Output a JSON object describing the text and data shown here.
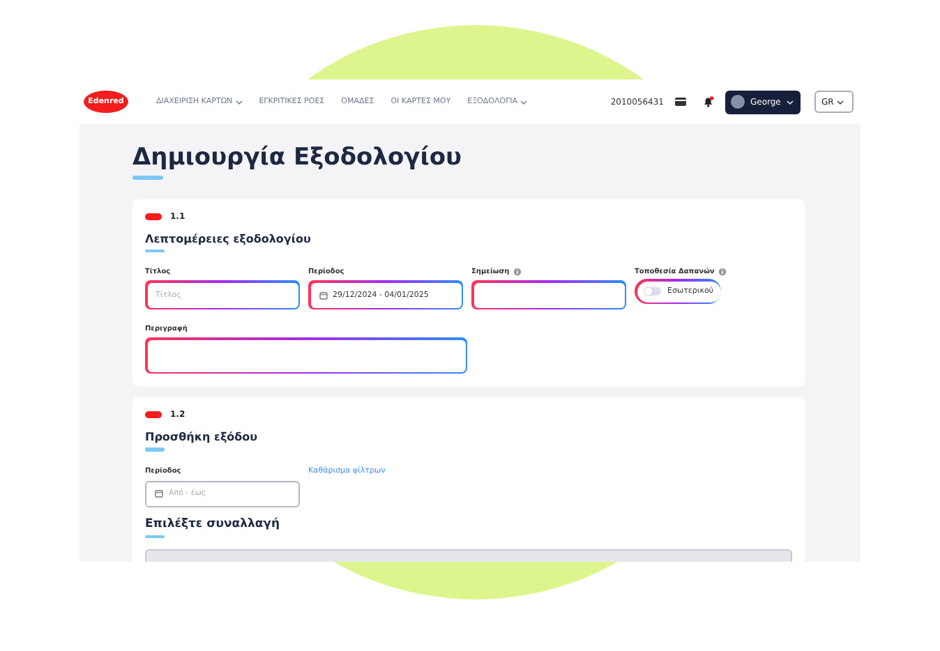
{
  "header": {
    "logo": "Edenred",
    "nav": [
      {
        "label": "ΔΙΑΧΕΙΡΙΣΗ ΚΑΡΤΩΝ",
        "dropdown": true
      },
      {
        "label": "ΕΓΚΡΙΤΙΚΕΣ ΡΟΕΣ",
        "dropdown": false
      },
      {
        "label": "ΟΜΑΔΕΣ",
        "dropdown": false
      },
      {
        "label": "ΟΙ ΚΑΡΤΕΣ ΜΟΥ",
        "dropdown": false
      },
      {
        "label": "ΕΞΟΔΟΛΟΓΙΑ",
        "dropdown": true
      }
    ],
    "account": "2010056431",
    "notification": true,
    "user": "George",
    "language": "GR"
  },
  "page": {
    "title": "Δημιουργία Εξοδολογίου"
  },
  "details": {
    "number": "1.1",
    "title": "Λεπτομέρειες εξοδολογίου",
    "fields": [
      {
        "kind": "text",
        "label": "Τίτλος",
        "info": false,
        "placeholder": "Τίτλος"
      },
      {
        "kind": "date",
        "label": "Περίοδος",
        "info": false,
        "value": "29/12/2024 - 04/01/2025"
      },
      {
        "kind": "text",
        "label": "Σημείωση",
        "info": true
      },
      {
        "kind": "toggle",
        "label": "Τοποθεσία Δαπανών",
        "info": true,
        "option": "Εσωτερικού",
        "on": false
      },
      {
        "kind": "textarea",
        "label": "Περιγραφή",
        "info": false
      }
    ]
  },
  "expense": {
    "number": "1.2",
    "title": "Προσθήκη εξόδου",
    "period_label": "Περίοδος",
    "clear_link": "Καθάρισμα φίλτρων",
    "period_placeholder": "Από - έως",
    "subtitle": "Επιλέξτε συναλλαγή"
  }
}
